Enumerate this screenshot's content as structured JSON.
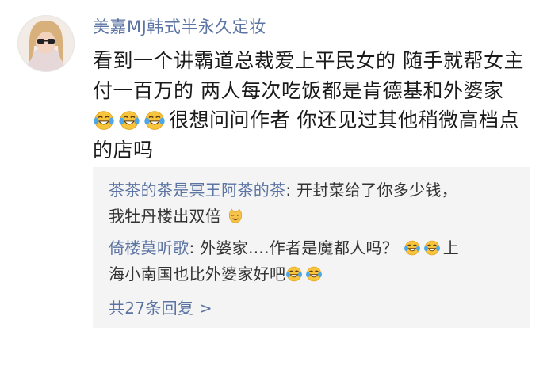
{
  "comment": {
    "username": "美嘉MJ韩式半永久定妆",
    "line1": "看到一个讲霸道总裁爱上平民女的 随手就帮女主",
    "line2": "付一百万的 两人每次吃饭都是肯德基和外婆家",
    "line3_text": "很想问问作者 你还见过其他稍微高档点",
    "line4": "的店吗",
    "line3_emojis": [
      "laughing-crying-emoji",
      "laughing-crying-emoji",
      "laughing-crying-emoji"
    ]
  },
  "replies": [
    {
      "name": "茶茶的茶是冥王阿茶的茶",
      "line1_text": ": 开封菜给了你多少钱，",
      "line2_text": "我牡丹楼出双倍",
      "emoji": "cat-smile-emoji"
    },
    {
      "name": "倚楼莫听歌",
      "line1_text": ": 外婆家....作者是魔都人吗？",
      "line1_suffix": "上",
      "line2_text": "海小南国也比外婆家好吧"
    }
  ],
  "more_replies": "共27条回复 >",
  "colors": {
    "name_blue": "#5b74a3",
    "reply_bg": "#f4f4f4",
    "text": "#1a1a1a"
  }
}
